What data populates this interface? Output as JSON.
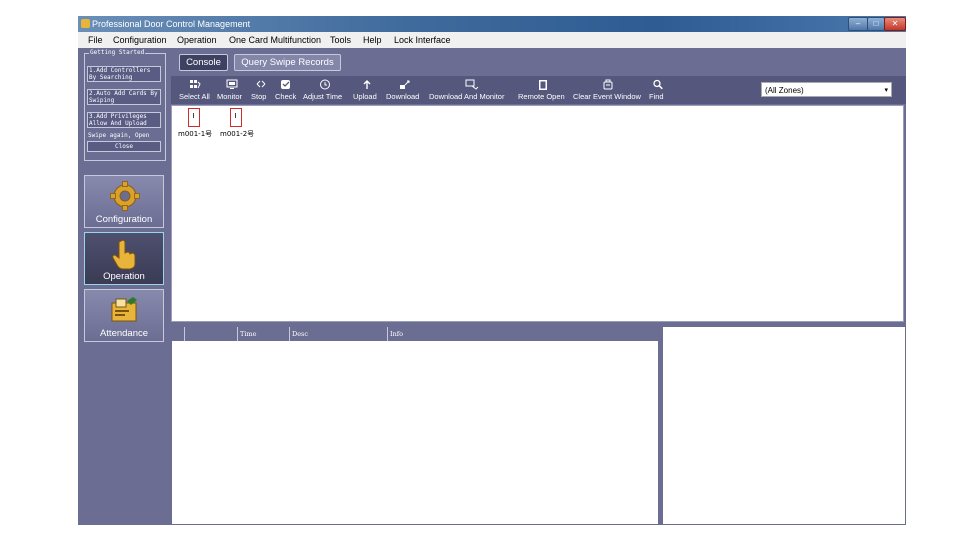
{
  "window": {
    "title": "Professional Door Control Management"
  },
  "menu": [
    "File",
    "Configuration",
    "Operation",
    "One Card Multifunction",
    "Tools",
    "Help",
    "Lock Interface"
  ],
  "getting_started": {
    "title": "Getting Started",
    "steps": [
      "1.Add Controllers By Searching",
      "2.Auto Add Cards By Swiping",
      "3.Add Privileges Allow And Upload"
    ],
    "swipe_text": "Swipe again, Open",
    "close_label": "Close"
  },
  "nav": [
    {
      "label": "Configuration",
      "icon": "gear-icon"
    },
    {
      "label": "Operation",
      "icon": "hand-pointer-icon"
    },
    {
      "label": "Attendance",
      "icon": "attendance-icon"
    }
  ],
  "tabs": [
    "Console",
    "Query Swipe Records"
  ],
  "toolbar": {
    "buttons": [
      {
        "label": "Select All",
        "icon": "select-all-icon"
      },
      {
        "label": "Monitor",
        "icon": "monitor-icon"
      },
      {
        "label": "Stop",
        "icon": "stop-icon"
      },
      {
        "label": "Check",
        "icon": "check-icon"
      },
      {
        "label": "Adjust Time",
        "icon": "clock-icon"
      },
      {
        "label": "Upload",
        "icon": "upload-icon"
      },
      {
        "label": "Download",
        "icon": "download-icon"
      },
      {
        "label": "Download And Monitor",
        "icon": "download-monitor-icon"
      },
      {
        "label": "Remote Open",
        "icon": "door-icon"
      },
      {
        "label": "Clear Event Window",
        "icon": "clear-icon"
      },
      {
        "label": "Find",
        "icon": "search-icon"
      }
    ],
    "zone_value": "(All Zones)"
  },
  "doors": [
    "m001-1号",
    "m001-2号"
  ],
  "log_columns": [
    "",
    "",
    "Time",
    "Desc",
    "Info"
  ]
}
